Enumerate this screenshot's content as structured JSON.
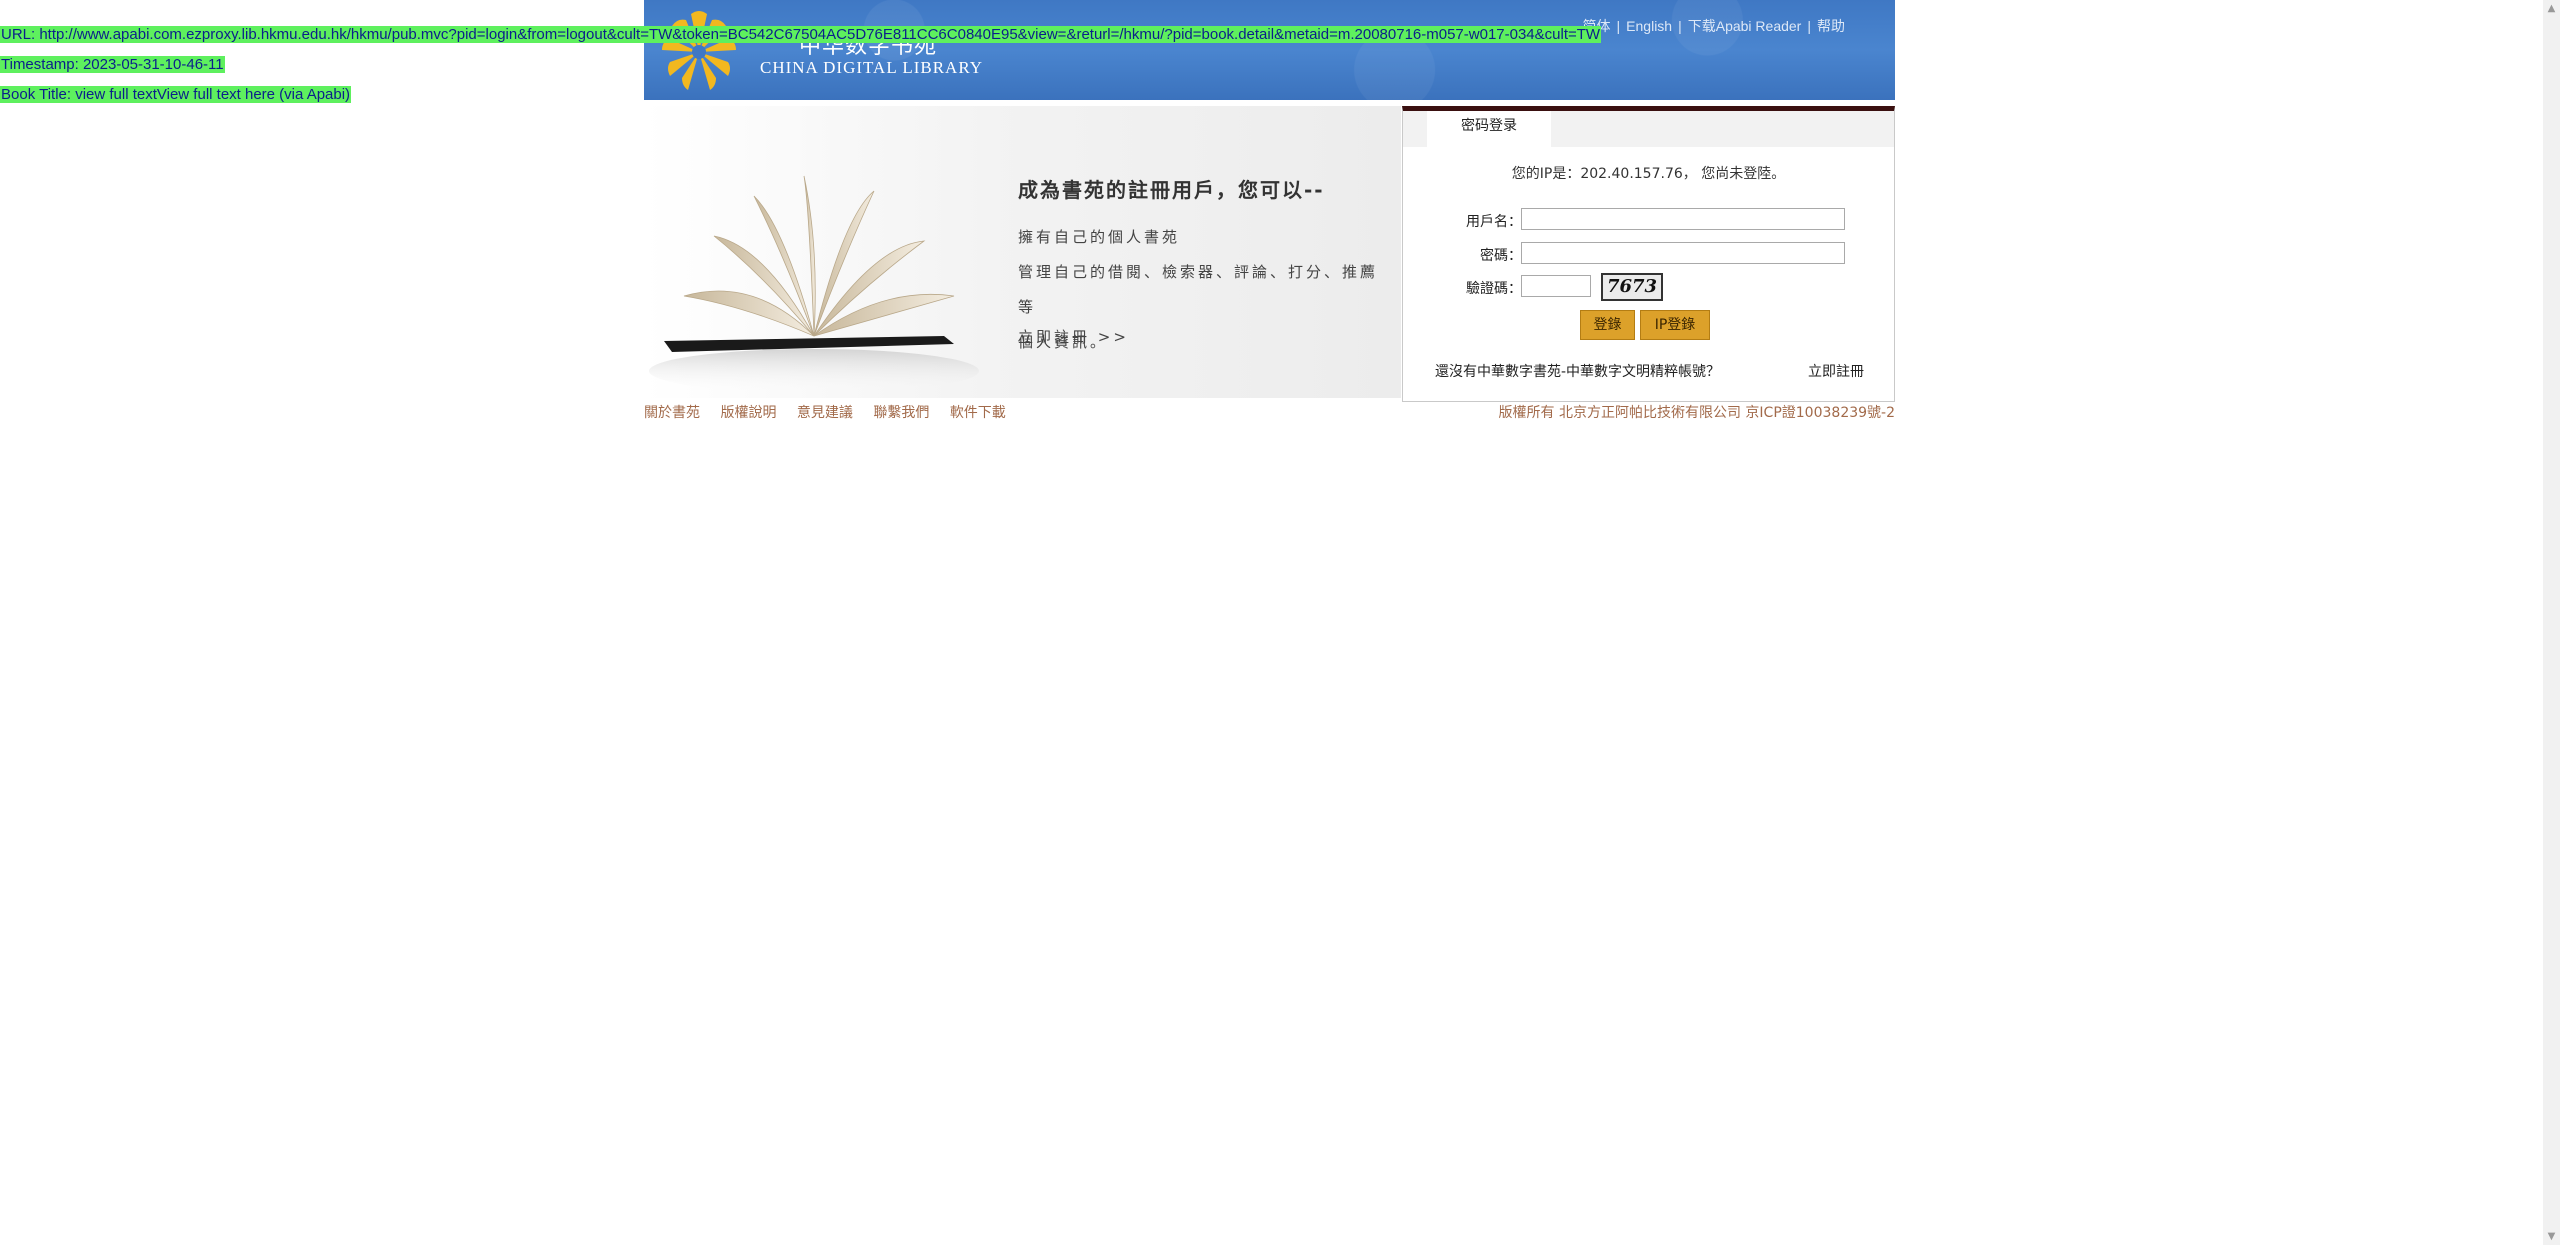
{
  "overlay": {
    "url": "URL: http://www.apabi.com.ezproxy.lib.hkmu.edu.hk/hkmu/pub.mvc?pid=login&from=logout&cult=TW&token=BC542C67504AC5D76E811CC6C0840E95&view=&returl=/hkmu/?pid=book.detail&metaid=m.20080716-m057-w017-034&cult=TW",
    "timestamp": "Timestamp: 2023-05-31-10-46-11",
    "book_title": "Book Title: view full textView full text here (via Apabi)"
  },
  "header": {
    "logo_cn": "中华数字书苑",
    "logo_en": "CHINA DIGITAL LIBRARY",
    "nav": [
      "简体",
      "English",
      "下载Apabi Reader",
      "帮助"
    ]
  },
  "promo": {
    "title": "成為書苑的註冊用戶，您可以--",
    "items": [
      "擁有自己的個人書苑",
      "管理自己的借閱、檢索器、評論、打分、推薦等",
      "個人資訊。"
    ],
    "register_link": "立即註冊 >>"
  },
  "login": {
    "tab_label": "密码登录",
    "ip_info": "您的IP是：202.40.157.76， 您尚未登陸。",
    "username_label": "用戶名：",
    "password_label": "密碼：",
    "captcha_label": "驗證碼：",
    "captcha_code": "7673",
    "login_button": "登錄",
    "ip_login_button": "IP登錄",
    "no_account_text": "還沒有中華數字書苑-中華數字文明精粹帳號？",
    "register_now": "立即註冊"
  },
  "footer": {
    "links": [
      "關於書苑",
      "版權說明",
      "意見建議",
      "聯繫我們",
      "軟件下載"
    ],
    "copyright": "版權所有  北京方正阿帕比技術有限公司  京ICP證10038239號-2"
  },
  "colors": {
    "overlay_bg": "#5ef05e",
    "header_blue": "#4a85cf",
    "button_gold": "#dca12a",
    "footer_text": "#a26a4a"
  }
}
